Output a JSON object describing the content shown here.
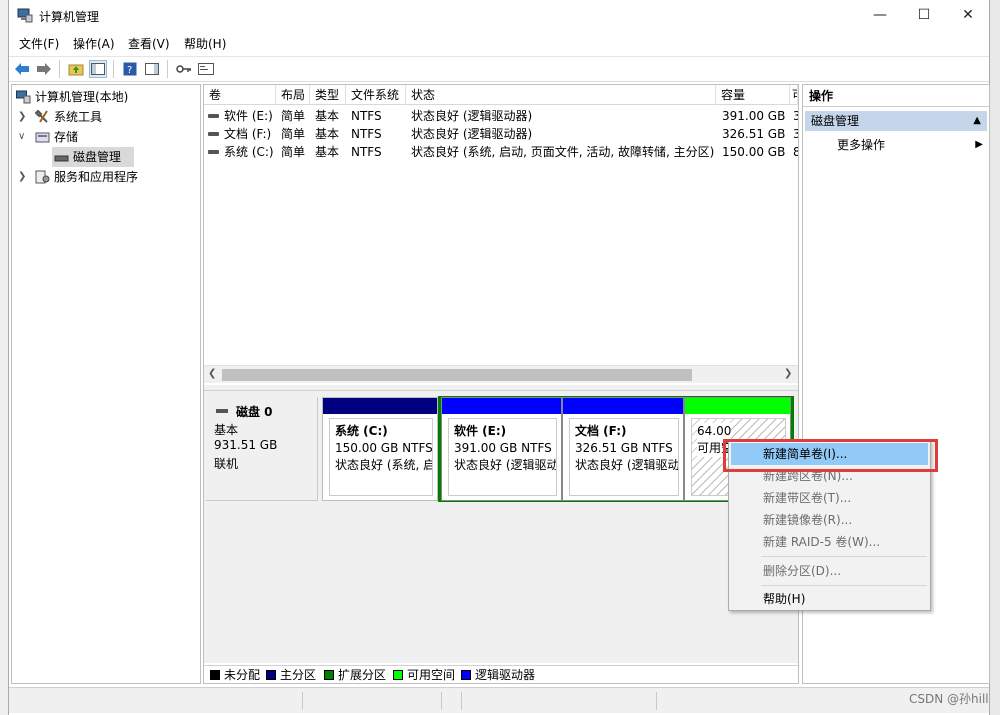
{
  "window": {
    "title": "计算机管理"
  },
  "menu": [
    "文件(F)",
    "操作(A)",
    "查看(V)",
    "帮助(H)"
  ],
  "tree": {
    "root": "计算机管理(本地)",
    "items": [
      {
        "label": "系统工具"
      },
      {
        "label": "存储"
      },
      {
        "label": "磁盘管理"
      },
      {
        "label": "服务和应用程序"
      }
    ]
  },
  "columns": [
    "卷",
    "布局",
    "类型",
    "文件系统",
    "状态",
    "容量",
    "可"
  ],
  "volumes": [
    {
      "name": "软件 (E:)",
      "layout": "简单",
      "type": "基本",
      "fs": "NTFS",
      "status": "状态良好 (逻辑驱动器)",
      "capacity": "391.00 GB",
      "extra": "3"
    },
    {
      "name": "文档 (F:)",
      "layout": "简单",
      "type": "基本",
      "fs": "NTFS",
      "status": "状态良好 (逻辑驱动器)",
      "capacity": "326.51 GB",
      "extra": "3"
    },
    {
      "name": "系统 (C:)",
      "layout": "简单",
      "type": "基本",
      "fs": "NTFS",
      "status": "状态良好 (系统, 启动, 页面文件, 活动, 故障转储, 主分区)",
      "capacity": "150.00 GB",
      "extra": "8"
    }
  ],
  "disk": {
    "name": "磁盘 0",
    "kind": "基本",
    "size": "931.51 GB",
    "state": "联机"
  },
  "partitions": [
    {
      "title": "系统 (C:)",
      "size": "150.00 GB NTFS",
      "status": "状态良好 (系统, 启动"
    },
    {
      "title": "软件 (E:)",
      "size": "391.00 GB NTFS",
      "status": "状态良好 (逻辑驱动"
    },
    {
      "title": "文档 (F:)",
      "size": "326.51 GB NTFS",
      "status": "状态良好 (逻辑驱动器"
    },
    {
      "title": "",
      "size": "64.00",
      "status": "可用空"
    }
  ],
  "legend": [
    {
      "label": "未分配",
      "color": "#000000"
    },
    {
      "label": "主分区",
      "color": "#000080"
    },
    {
      "label": "扩展分区",
      "color": "#008000"
    },
    {
      "label": "可用空间",
      "color": "#00ff00"
    },
    {
      "label": "逻辑驱动器",
      "color": "#0000ff"
    }
  ],
  "actions": {
    "header": "操作",
    "section": "磁盘管理",
    "more": "更多操作"
  },
  "context_menu": [
    "新建简单卷(I)...",
    "新建跨区卷(N)...",
    "新建带区卷(T)...",
    "新建镜像卷(R)...",
    "新建 RAID-5 卷(W)...",
    "删除分区(D)...",
    "帮助(H)"
  ],
  "colors": {
    "primary": "#000080",
    "logical": "#0000ff",
    "free": "#00ff00",
    "extended": "#008000",
    "highlight": "#91c9f7",
    "callout": "#e03c3c"
  },
  "watermark": "CSDN @孙hill"
}
